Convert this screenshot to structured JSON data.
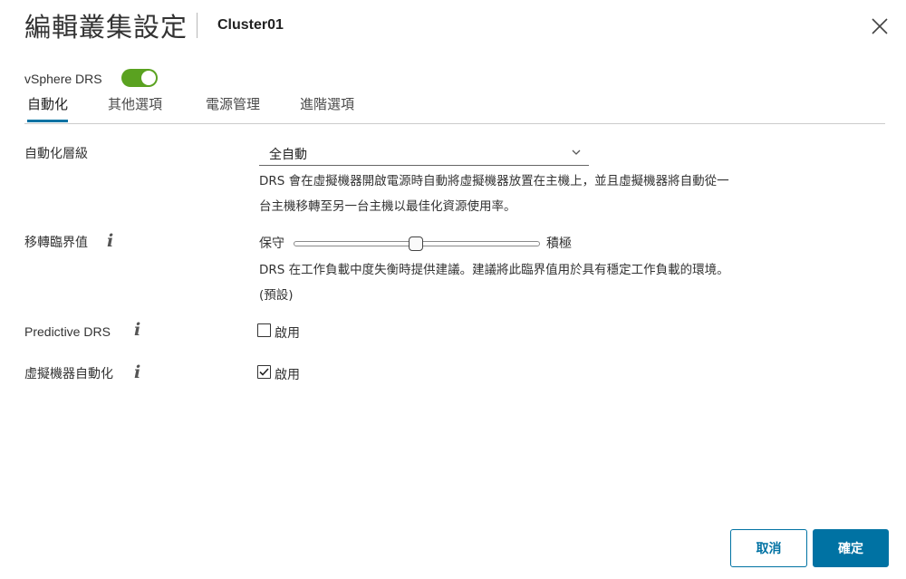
{
  "header": {
    "title": "編輯叢集設定",
    "cluster_name": "Cluster01",
    "close_icon": "close-icon"
  },
  "drs": {
    "label": "vSphere DRS",
    "enabled": true,
    "toggle_color": "#5aa220"
  },
  "tabs": [
    {
      "label": "自動化",
      "active": true
    },
    {
      "label": "其他選項",
      "active": false
    },
    {
      "label": "電源管理",
      "active": false
    },
    {
      "label": "進階選項",
      "active": false
    }
  ],
  "automation": {
    "level_label": "自動化層級",
    "level_value": "全自動",
    "level_desc_line1": "DRS 會在虛擬機器開啟電源時自動將虛擬機器放置在主機上，並且虛擬機器將自動從一",
    "level_desc_line2": "台主機移轉至另一台主機以最佳化資源使用率。",
    "threshold_label": "移轉臨界值",
    "threshold_min": "保守",
    "threshold_max": "積極",
    "threshold_level_fraction": 0.5,
    "threshold_desc": "DRS 在工作負載中度失衡時提供建議。建議將此臨界值用於具有穩定工作負載的環境。",
    "threshold_default": "(預設)",
    "predictive_label": "Predictive DRS",
    "predictive_checkbox_label": "啟用",
    "predictive_checked": false,
    "vm_automation_label": "虛擬機器自動化",
    "vm_automation_checkbox_label": "啟用",
    "vm_automation_checked": true,
    "info_glyph": "i"
  },
  "footer": {
    "cancel_label": "取消",
    "ok_label": "確定"
  },
  "colors": {
    "accent": "#0072a3"
  }
}
